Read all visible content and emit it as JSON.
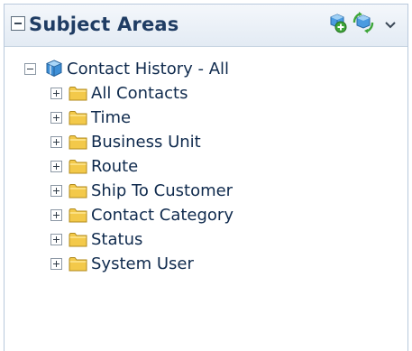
{
  "panel": {
    "title": "Subject Areas",
    "icons": {
      "collapse": "collapse-box-icon",
      "add": "add-subject-area-icon",
      "refresh": "refresh-icon",
      "menu": "chevron-down-icon"
    }
  },
  "tree": {
    "root": {
      "label": "Contact History - All",
      "icon": "subject-area-cube-icon",
      "expanded": true
    },
    "folders": [
      {
        "label": "All Contacts"
      },
      {
        "label": "Time"
      },
      {
        "label": "Business Unit"
      },
      {
        "label": "Route"
      },
      {
        "label": "Ship To Customer"
      },
      {
        "label": "Contact Category"
      },
      {
        "label": "Status"
      },
      {
        "label": "System User"
      }
    ]
  },
  "colors": {
    "title": "#1f3c63",
    "folder": "#f3c94a",
    "cube": "#3e8fd6",
    "add_badge": "#3fa63a"
  }
}
